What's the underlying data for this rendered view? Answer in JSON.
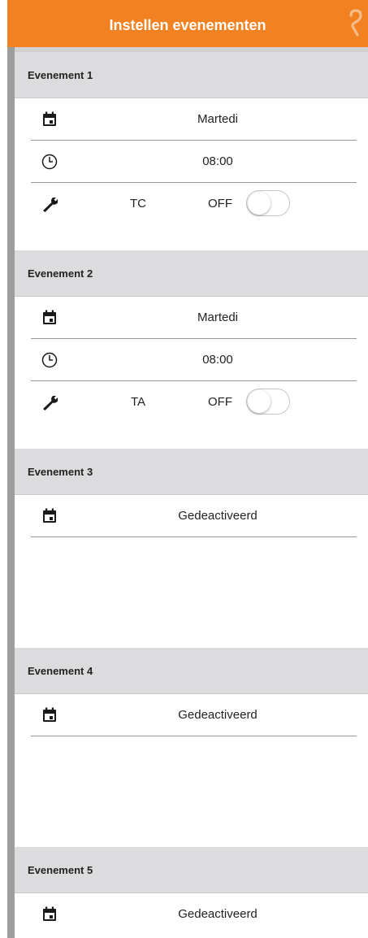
{
  "header": {
    "title": "Instellen evenementen",
    "help_icon": "help-icon",
    "color": "#f28121"
  },
  "events": [
    {
      "title": "Evenement 1",
      "day": "Martedi",
      "time": "08:00",
      "tag": "TC",
      "state": "OFF"
    },
    {
      "title": "Evenement 2",
      "day": "Martedi",
      "time": "08:00",
      "tag": "TA",
      "state": "OFF"
    },
    {
      "title": "Evenement 3",
      "day": "Gedeactiveerd"
    },
    {
      "title": "Evenement 4",
      "day": "Gedeactiveerd"
    },
    {
      "title": "Evenement 5",
      "day": "Gedeactiveerd"
    }
  ],
  "icons": {
    "calendar": "calendar-icon",
    "clock": "clock-icon",
    "wrench": "wrench-icon"
  }
}
